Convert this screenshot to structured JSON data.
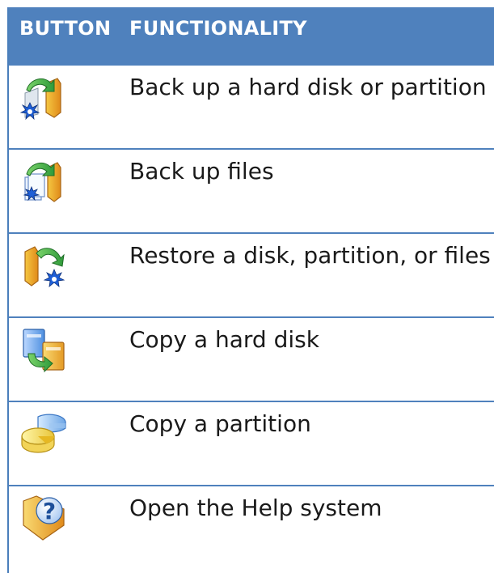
{
  "header": {
    "button_col": "BUTTON",
    "functionality_col": "FUNCTIONALITY"
  },
  "rows": [
    {
      "icon": "backup-disk-icon",
      "label": "Back up a hard disk or partition"
    },
    {
      "icon": "backup-files-icon",
      "label": "Back up files"
    },
    {
      "icon": "restore-icon",
      "label": "Restore a disk, partition, or files"
    },
    {
      "icon": "copy-disk-icon",
      "label": "Copy a hard disk"
    },
    {
      "icon": "copy-partition-icon",
      "label": "Copy a partition"
    },
    {
      "icon": "help-icon",
      "label": "Open the Help system"
    }
  ],
  "colors": {
    "header_bg": "#4f81bd",
    "header_text": "#ffffff",
    "rule": "#4f81bd"
  }
}
